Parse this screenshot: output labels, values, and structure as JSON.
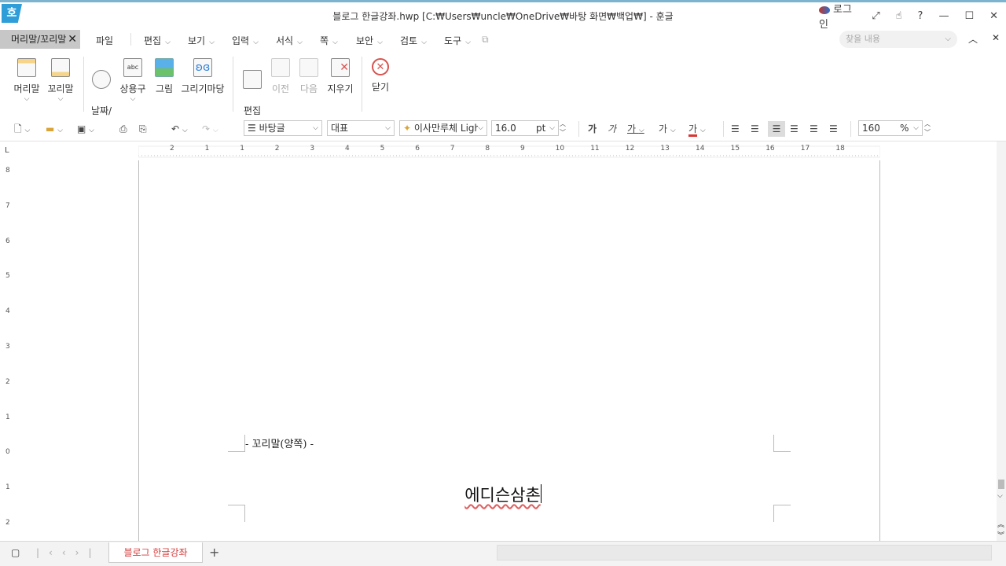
{
  "window": {
    "title": "블로그 한글강좌.hwp [C:₩Users₩uncle₩OneDrive₩바탕 화면₩백업₩] - 훈글",
    "app_icon": "호",
    "login_label": "로그인",
    "controls": [
      "⤢",
      "☝",
      "?",
      "—",
      "☐",
      "✕"
    ]
  },
  "menubar": {
    "active_tab": "머리말/꼬리말",
    "items": [
      "파일",
      "편집",
      "보기",
      "입력",
      "서식",
      "쪽",
      "보안",
      "검토",
      "도구"
    ],
    "search_placeholder": "찾을 내용"
  },
  "ribbon": {
    "buttons": [
      {
        "label": "머리말",
        "has_dropdown": true,
        "enabled": true
      },
      {
        "label": "꼬리말",
        "has_dropdown": true,
        "enabled": true
      },
      {
        "label": "날짜/\n시간",
        "has_dropdown": false,
        "enabled": true
      },
      {
        "label": "상용구",
        "has_dropdown": true,
        "enabled": true
      },
      {
        "label": "그림",
        "has_dropdown": false,
        "enabled": true
      },
      {
        "label": "그리기마당",
        "has_dropdown": false,
        "enabled": true
      },
      {
        "label": "편집\n용지",
        "has_dropdown": false,
        "enabled": true
      },
      {
        "label": "이전",
        "has_dropdown": false,
        "enabled": false
      },
      {
        "label": "다음",
        "has_dropdown": false,
        "enabled": false
      },
      {
        "label": "지우기",
        "has_dropdown": false,
        "enabled": true
      },
      {
        "label": "닫기",
        "has_dropdown": false,
        "enabled": true
      }
    ]
  },
  "toolbar": {
    "style": "바탕글",
    "lang": "대표",
    "font": "이사만루체 Ligh",
    "size": "16.0",
    "size_unit": "pt",
    "char_buttons": [
      "가",
      "가",
      "가",
      "가",
      "가"
    ],
    "zoom": "160",
    "zoom_unit": "%"
  },
  "ruler": {
    "h_ticks": [
      "2",
      "1",
      "1",
      "2",
      "3",
      "4",
      "5",
      "6",
      "7",
      "8",
      "9",
      "10",
      "11",
      "12",
      "13",
      "14",
      "15",
      "16",
      "17",
      "18"
    ],
    "v_ticks": [
      "8",
      "7",
      "6",
      "5",
      "4",
      "3",
      "2",
      "1",
      "0",
      "1",
      "2"
    ],
    "corner": "L"
  },
  "document": {
    "footer_label": "- 꼬리말(양쪽) -",
    "footer_text": "에디슨삼촌"
  },
  "statusbar": {
    "sheet_tab": "블로그 한글강좌",
    "add_tab": "+"
  },
  "colors": {
    "accent": "#2f9ed8",
    "active_tab_bg": "#c7c7c7",
    "sheet_tab_text": "#d33a3a",
    "close_icon": "#d9534f"
  }
}
